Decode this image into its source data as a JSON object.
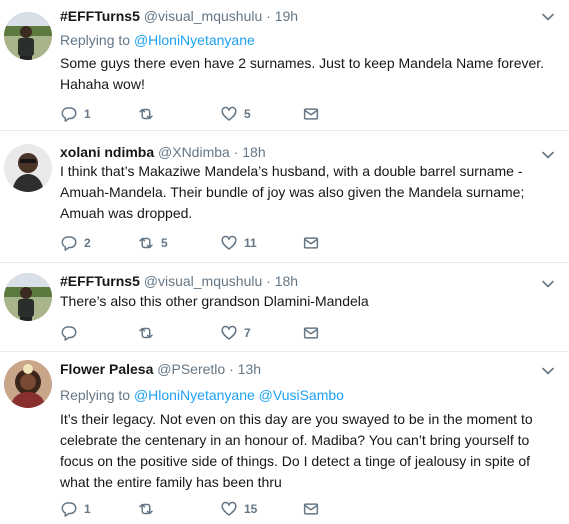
{
  "tweets": [
    {
      "display_name": "#EFFTurns5",
      "handle": "@visual_mqushulu",
      "separator": "·",
      "time": "19h",
      "replying_prefix": "Replying to",
      "replying_to": [
        "@HloniNyetanyane"
      ],
      "text": "Some guys there even have 2 surnames.  Just to keep Mandela Name forever. Hahaha wow!",
      "replies": "1",
      "retweets": "",
      "likes": "5"
    },
    {
      "display_name": "xolani ndimba",
      "handle": "@XNdimba",
      "separator": "·",
      "time": "18h",
      "text": "I think that’s Makaziwe Mandela’s husband, with a double barrel surname - Amuah-Mandela. Their bundle of joy was also given the Mandela surname; Amuah was dropped.",
      "replies": "2",
      "retweets": "5",
      "likes": "11"
    },
    {
      "display_name": "#EFFTurns5",
      "handle": "@visual_mqushulu",
      "separator": "·",
      "time": "18h",
      "text": "There’s also this other grandson Dlamini-Mandela",
      "replies": "",
      "retweets": "",
      "likes": "7"
    },
    {
      "display_name": "Flower Palesa",
      "handle": "@PSeretlo",
      "separator": "·",
      "time": "13h",
      "replying_prefix": "Replying to",
      "replying_to": [
        "@HloniNyetanyane",
        "@VusiSambo"
      ],
      "text": "It’s their legacy. Not even on this day are you swayed to be in the moment to celebrate the centenary in an honour of. Madiba? You can’t bring yourself to focus on the positive side of things. Do I detect a tinge of jealousy in spite of what the entire family has been thru",
      "replies": "1",
      "retweets": "",
      "likes": "15"
    }
  ],
  "icons": {
    "reply": "reply-icon",
    "retweet": "retweet-icon",
    "like": "heart-icon",
    "dm": "envelope-icon",
    "caret": "chevron-down-icon"
  },
  "colors": {
    "link": "#1da1f2",
    "secondary_text": "#657786",
    "primary_text": "#14171a",
    "thread_line": "#ccd6dd",
    "divider": "#e6ecf0"
  }
}
